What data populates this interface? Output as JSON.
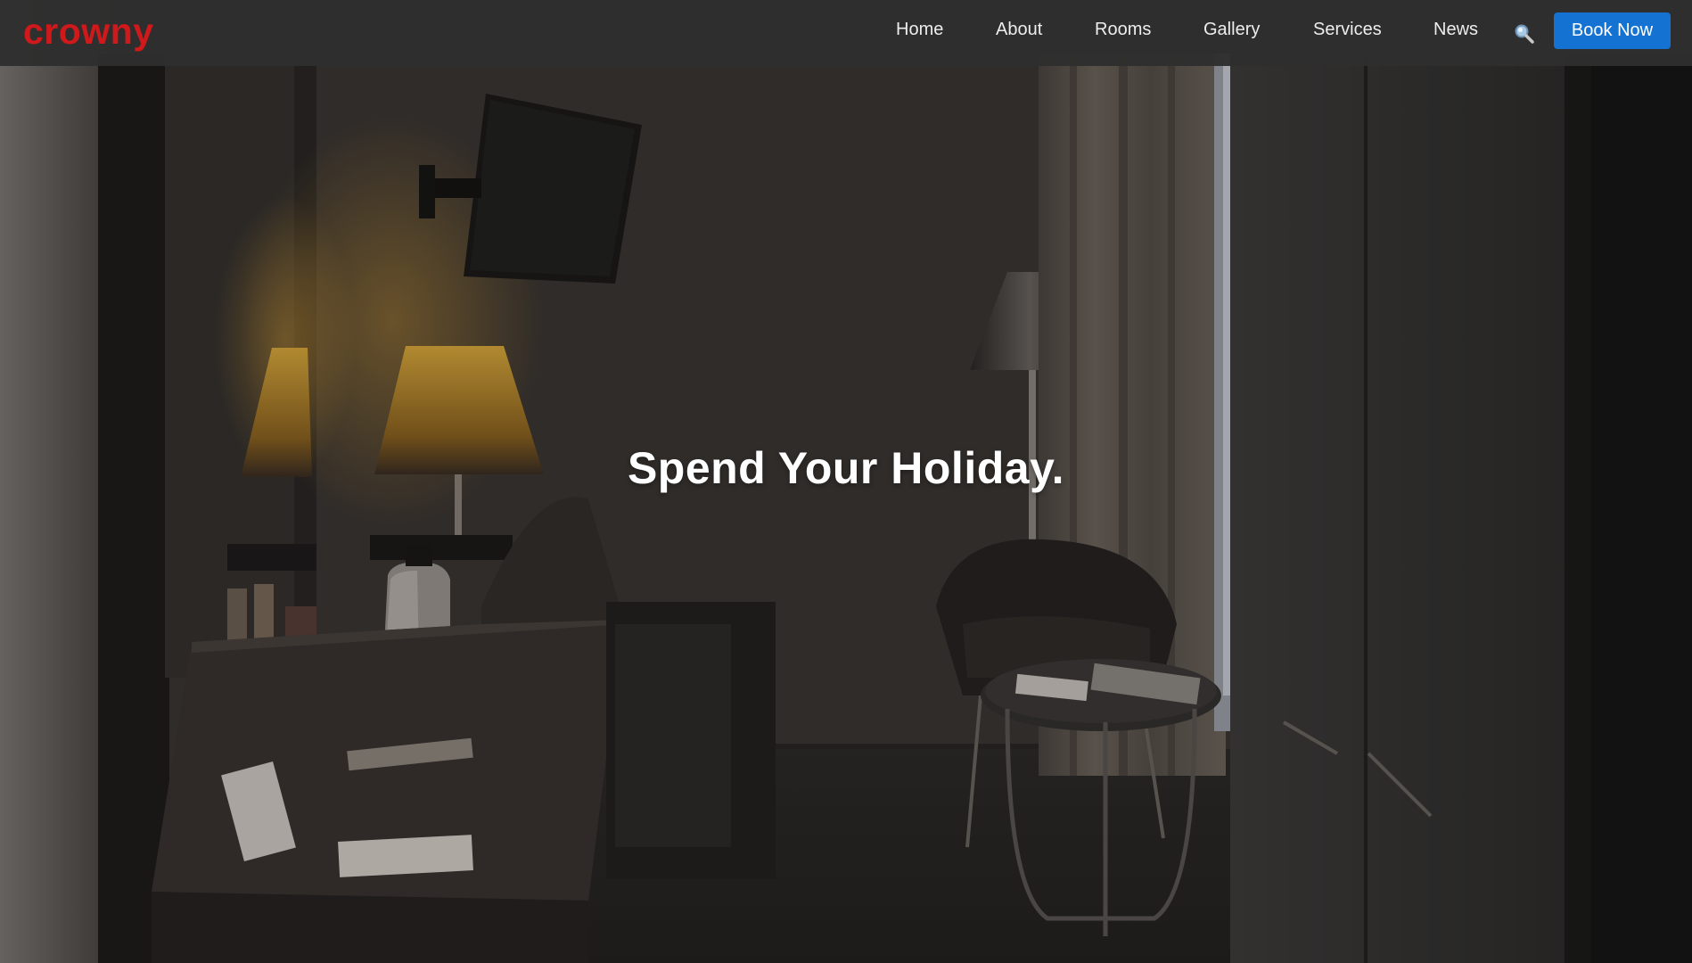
{
  "brand": {
    "logo_text": "crowny",
    "logo_color": "#d0191b"
  },
  "nav": {
    "items": [
      {
        "label": "Home"
      },
      {
        "label": "About"
      },
      {
        "label": "Rooms"
      },
      {
        "label": "Gallery"
      },
      {
        "label": "Services"
      },
      {
        "label": "News"
      }
    ],
    "search_icon": "search-icon",
    "cta_label": "Book Now",
    "cta_color": "#1473d2"
  },
  "hero": {
    "headline": "Spend Your Holiday.",
    "background_image": "dimly lit hotel room with desk, lamps, TV, armchair, side table and wardrobe"
  }
}
